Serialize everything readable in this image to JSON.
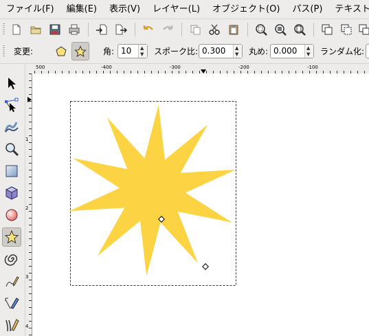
{
  "menubar": {
    "items": [
      "ファイル(F)",
      "編集(E)",
      "表示(V)",
      "レイヤー(L)",
      "オブジェクト(O)",
      "パス(P)",
      "テキスト(T)"
    ]
  },
  "toolbar": {
    "icons": [
      "new-document-icon",
      "open-icon",
      "save-icon",
      "print-icon",
      "import-icon",
      "export-icon",
      "undo-icon",
      "redo-icon",
      "copy-icon",
      "cut-icon",
      "paste-icon",
      "zoom-selection-icon",
      "zoom-drawing-icon",
      "zoom-page-icon",
      "duplicate-icon",
      "clone-icon",
      "unlink-clone-icon"
    ]
  },
  "tool_controls": {
    "change_label": "変更:",
    "corners_label": "角:",
    "corners_value": "10",
    "spoke_ratio_label": "スポーク比:",
    "spoke_ratio_value": "0.300",
    "rounded_label": "丸め:",
    "rounded_value": "0.000",
    "randomized_label": "ランダム化:",
    "mode": "star"
  },
  "rulers": {
    "horizontal_labels": [
      "500",
      "-400",
      "-300",
      "-200",
      "-100"
    ],
    "vertical_labels": [
      "1",
      "2",
      "3",
      "4"
    ]
  },
  "toolbox": {
    "tools": [
      "selector-tool",
      "node-tool",
      "tweak-tool",
      "zoom-tool",
      "rectangle-tool",
      "3d-box-tool",
      "ellipse-tool",
      "star-tool",
      "spiral-tool",
      "pencil-tool",
      "pen-tool",
      "calligraphy-tool"
    ],
    "active_tool": "star-tool"
  },
  "canvas": {
    "star": {
      "corners": 10,
      "spoke_ratio": 0.3,
      "rounded": 0.0,
      "fill": "#fcd443"
    },
    "selection_bbox": "dashed"
  }
}
